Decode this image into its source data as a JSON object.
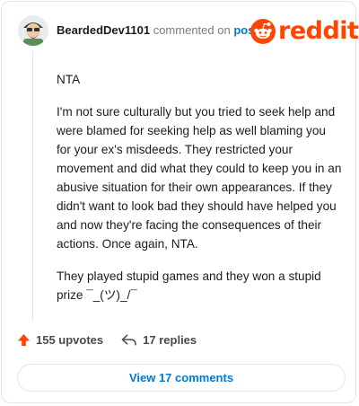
{
  "comment": {
    "username": "BeardedDev1101",
    "action_text": "commented on",
    "post_link": "post",
    "paragraphs": [
      "NTA",
      "I'm not sure culturally but you tried to seek help and were blamed for seeking help as well blaming you for your ex's misdeeds. They restricted your movement and did what they could to keep you in an abusive situation for their own appearances. If they didn't want to look bad they should have helped you and now they're facing the consequences of their actions. Once again, NTA.",
      "They played stupid games and they won a stupid prize ¯_(ツ)_/¯"
    ]
  },
  "branding": {
    "logo_text": "reddit",
    "accent": "#ff4500"
  },
  "footer": {
    "upvotes": "155 upvotes",
    "replies": "17 replies"
  },
  "view_comments_label": "View 17 comments",
  "colors": {
    "link": "#0079d3",
    "upvote": "#ff4500",
    "muted": "#7c7c7c"
  }
}
